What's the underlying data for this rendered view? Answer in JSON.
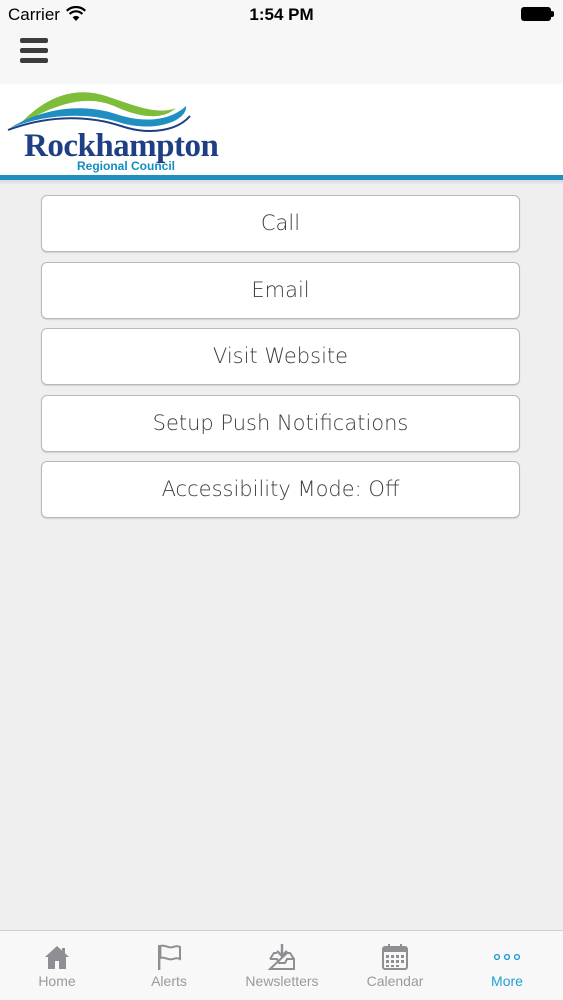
{
  "status_bar": {
    "carrier": "Carrier",
    "time": "1:54 PM"
  },
  "header": {
    "logo_title": "Rockhampton",
    "logo_subtitle": "Regional Council"
  },
  "menu": {
    "items": [
      {
        "label": "Call"
      },
      {
        "label": "Email"
      },
      {
        "label": "Visit Website"
      },
      {
        "label": "Setup Push Notifications"
      },
      {
        "label": "Accessibility Mode: Off"
      }
    ]
  },
  "tab_bar": {
    "tabs": [
      {
        "label": "Home",
        "icon": "home-icon"
      },
      {
        "label": "Alerts",
        "icon": "flag-icon"
      },
      {
        "label": "Newsletters",
        "icon": "inbox-download-icon"
      },
      {
        "label": "Calendar",
        "icon": "calendar-icon"
      },
      {
        "label": "More",
        "icon": "more-dots-icon"
      }
    ],
    "active": "More"
  },
  "colors": {
    "accent": "#1f9fd6",
    "brand_navy": "#1f3f84",
    "brand_green": "#7dbd3a",
    "stripe_blue": "#1e8fc0"
  }
}
